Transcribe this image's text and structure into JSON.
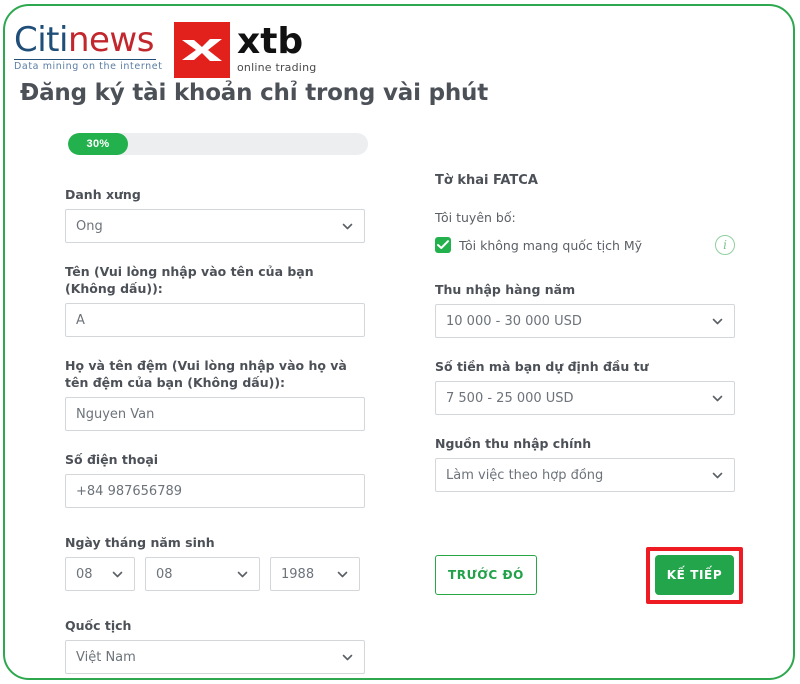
{
  "branding": {
    "citinews": {
      "word_primary": "Citi",
      "word_secondary": "news",
      "tagline": "Data mining on the internet",
      "color_primary": "#1f4e79",
      "color_secondary": "#c1272d"
    },
    "xtb": {
      "name": "xtb",
      "subtitle": "online trading",
      "mark_color": "#e2211c"
    }
  },
  "header": {
    "title": "Đăng ký tài khoản chỉ trong vài phút"
  },
  "progress": {
    "label": "30%",
    "percent": 30,
    "fill_color": "#23b14d",
    "track_color": "#eceeef"
  },
  "left_column": {
    "salutation": {
      "label": "Danh xưng",
      "value": "Ông"
    },
    "first_name": {
      "label": "Tên (Vui lòng nhập vào tên của bạn (Không dấu)):",
      "value": "A"
    },
    "last_name": {
      "label": "Họ và tên đệm (Vui lòng nhập vào họ và tên đệm của bạn (Không dấu)):",
      "value": "Nguyen Van"
    },
    "phone": {
      "label": "Số điện thoại",
      "value": "+84 987656789"
    },
    "birth_date": {
      "label": "Ngày tháng năm sinh",
      "day": "08",
      "month": "08",
      "year": "1988"
    },
    "nationality": {
      "label": "Quốc tịch",
      "value": "Việt Nam"
    }
  },
  "right_column": {
    "fatca": {
      "heading": "Tờ khai FATCA",
      "declare_label": "Tôi tuyên bố:",
      "checkbox_label": "Tôi không mang quốc tịch Mỹ",
      "checked": true,
      "info_glyph": "i",
      "check_color": "#22b14c"
    },
    "annual_income": {
      "label": "Thu nhập hàng năm",
      "value": "10 000 - 30 000 USD"
    },
    "planned_investment": {
      "label": "Số tiền mà bạn dự định đầu tư",
      "value": "7 500 - 25 000 USD"
    },
    "income_source": {
      "label": "Nguồn thu nhập chính",
      "value": "Làm việc theo hợp đồng"
    }
  },
  "actions": {
    "previous_label": "TRƯỚC ĐÓ",
    "next_label": "KẾ TIẾP",
    "highlight_color": "#ee1c22",
    "next_color": "#22a54b"
  }
}
